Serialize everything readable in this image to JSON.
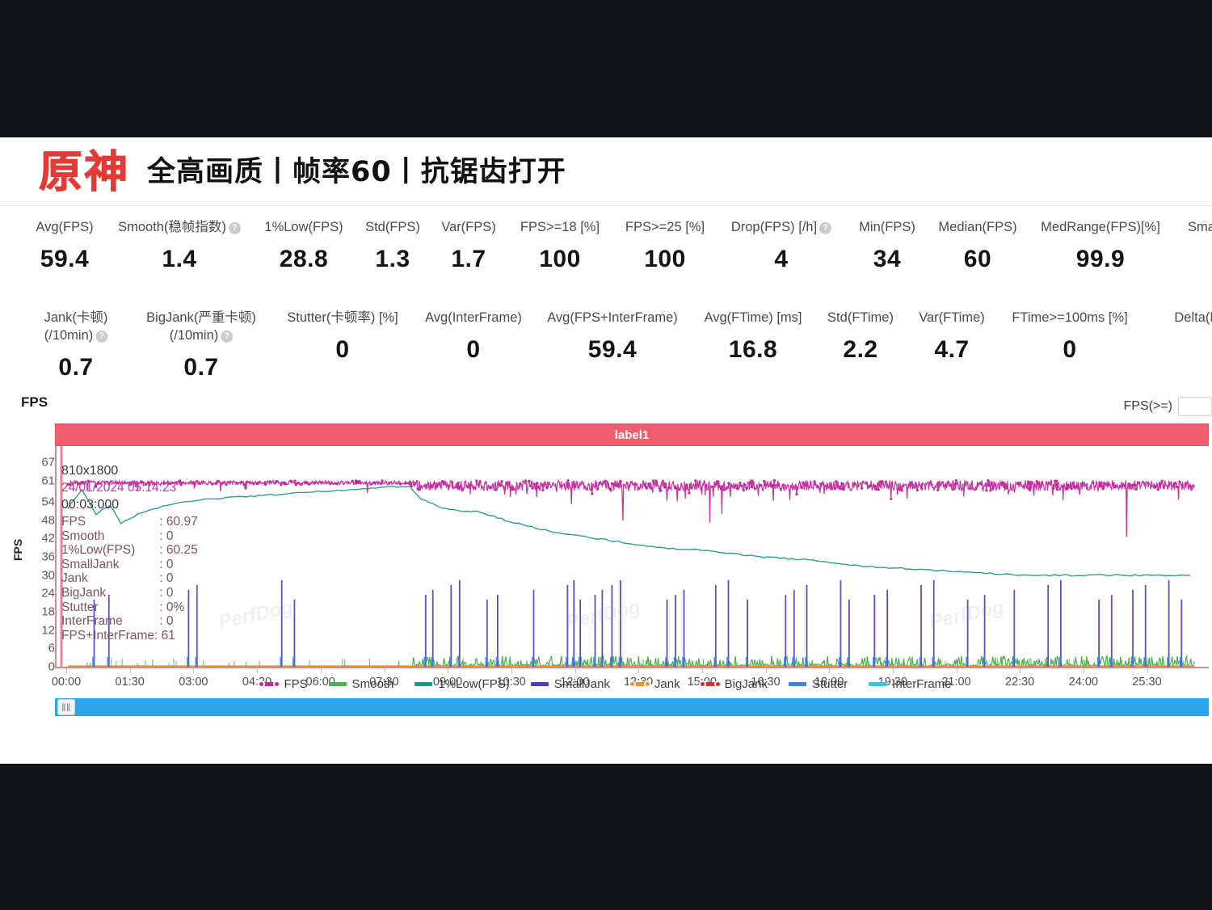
{
  "header": {
    "game_logo": "原神",
    "settings_text": "全高画质丨帧率60丨抗锯齿打开"
  },
  "stats_row1": [
    {
      "label": "Avg(FPS)",
      "value": "59.4",
      "help": false
    },
    {
      "label": "Smooth(稳帧指数)",
      "value": "1.4",
      "help": true
    },
    {
      "label": "1%Low(FPS)",
      "value": "28.8",
      "help": false
    },
    {
      "label": "Std(FPS)",
      "value": "1.3",
      "help": false
    },
    {
      "label": "Var(FPS)",
      "value": "1.7",
      "help": false
    },
    {
      "label": "FPS>=18 [%]",
      "value": "100",
      "help": false
    },
    {
      "label": "FPS>=25 [%]",
      "value": "100",
      "help": false
    },
    {
      "label": "Drop(FPS) [/h]",
      "value": "4",
      "help": true
    },
    {
      "label": "Min(FPS)",
      "value": "34",
      "help": false
    },
    {
      "label": "Median(FPS)",
      "value": "60",
      "help": false
    },
    {
      "label": "MedRange(FPS)[%]",
      "value": "99.9",
      "help": false
    },
    {
      "label": "Sma",
      "value": "",
      "help": false
    }
  ],
  "stats_row2": [
    {
      "label": "Jank(卡顿)",
      "sub": "(/10min)",
      "value": "0.7",
      "help": true
    },
    {
      "label": "BigJank(严重卡顿)",
      "sub": "(/10min)",
      "value": "0.7",
      "help": true
    },
    {
      "label": "Stutter(卡顿率) [%]",
      "sub": "",
      "value": "0",
      "help": false
    },
    {
      "label": "Avg(InterFrame)",
      "sub": "",
      "value": "0",
      "help": false
    },
    {
      "label": "Avg(FPS+InterFrame)",
      "sub": "",
      "value": "59.4",
      "help": false
    },
    {
      "label": "Avg(FTime) [ms]",
      "sub": "",
      "value": "16.8",
      "help": false
    },
    {
      "label": "Std(FTime)",
      "sub": "",
      "value": "2.2",
      "help": false
    },
    {
      "label": "Var(FTime)",
      "sub": "",
      "value": "4.7",
      "help": false
    },
    {
      "label": "FTime>=100ms [%]",
      "sub": "",
      "value": "0",
      "help": false
    },
    {
      "label": "Delta(FTi",
      "sub": "",
      "value": "",
      "help": false
    }
  ],
  "chart_panel": {
    "heading": "FPS",
    "filter_label": "FPS(>=)",
    "filter_value": "",
    "series_label_bar": "label1",
    "scroll_grip": "‖‖"
  },
  "tooltip": {
    "resolution": "810x1800",
    "datetime": "24/01/2024 05:14:23",
    "elapsed": "00:03:000",
    "rows": [
      {
        "key": "FPS",
        "value": ": 60.97"
      },
      {
        "key": "Smooth",
        "value": ": 0"
      },
      {
        "key": "1%Low(FPS)",
        "value": ": 60.25"
      },
      {
        "key": "SmallJank",
        "value": ": 0"
      },
      {
        "key": "Jank",
        "value": ": 0"
      },
      {
        "key": "BigJank",
        "value": ": 0"
      },
      {
        "key": "Stutter",
        "value": ": 0%"
      },
      {
        "key": "InterFrame",
        "value": ": 0"
      }
    ],
    "last_row": "FPS+InterFrame: 61"
  },
  "chart_data": {
    "type": "line",
    "title": "FPS",
    "xlabel": "",
    "ylabel": "FPS",
    "ylim": [
      0,
      70
    ],
    "yticks": [
      67,
      61,
      54,
      48,
      42,
      36,
      30,
      24,
      18,
      12,
      6,
      0
    ],
    "xticks": [
      "00:00",
      "01:30",
      "03:00",
      "04:30",
      "06:00",
      "07:30",
      "09:00",
      "10:30",
      "12:00",
      "13:30",
      "15:00",
      "16:30",
      "18:00",
      "19:30",
      "21:00",
      "22:30",
      "24:00",
      "25:30"
    ],
    "xlim_minutes": [
      0,
      26.5
    ],
    "grid": false,
    "legend_position": "bottom",
    "series": [
      {
        "name": "FPS",
        "color": "#c2299b",
        "type": "scatter-line",
        "description": "Dense magenta band oscillating around 59-61 across the whole run with occasional dips to 34-55.",
        "mean": 59.4,
        "min": 34,
        "max": 61
      },
      {
        "name": "Smooth",
        "color": "#4caf50",
        "type": "line",
        "description": "Green low-amplitude noise near 0-4 starting around 08:10.",
        "mean": 1.4
      },
      {
        "name": "1%Low(FPS)",
        "color": "#2e9e93",
        "type": "line",
        "description": "Teal curve: rises from ~48 at 00:00 to ~61 by 08:00, then declines steadily to ~30 by 21:00 and flattens near 30.",
        "points": [
          {
            "t": "00:00",
            "v": 52
          },
          {
            "t": "00:20",
            "v": 58
          },
          {
            "t": "00:40",
            "v": 50
          },
          {
            "t": "01:00",
            "v": 53
          },
          {
            "t": "01:15",
            "v": 47
          },
          {
            "t": "01:40",
            "v": 50
          },
          {
            "t": "02:20",
            "v": 53
          },
          {
            "t": "03:20",
            "v": 55
          },
          {
            "t": "04:30",
            "v": 56
          },
          {
            "t": "05:30",
            "v": 57
          },
          {
            "t": "06:40",
            "v": 58
          },
          {
            "t": "07:40",
            "v": 59
          },
          {
            "t": "08:05",
            "v": 59
          },
          {
            "t": "08:20",
            "v": 55
          },
          {
            "t": "08:50",
            "v": 52
          },
          {
            "t": "09:20",
            "v": 51
          },
          {
            "t": "09:40",
            "v": 51
          },
          {
            "t": "10:20",
            "v": 48
          },
          {
            "t": "11:10",
            "v": 45
          },
          {
            "t": "12:00",
            "v": 43
          },
          {
            "t": "13:00",
            "v": 41
          },
          {
            "t": "14:00",
            "v": 39
          },
          {
            "t": "15:10",
            "v": 38
          },
          {
            "t": "16:20",
            "v": 36
          },
          {
            "t": "17:30",
            "v": 35
          },
          {
            "t": "18:40",
            "v": 33
          },
          {
            "t": "20:00",
            "v": 32
          },
          {
            "t": "21:10",
            "v": 31
          },
          {
            "t": "22:30",
            "v": 30
          },
          {
            "t": "24:00",
            "v": 30
          },
          {
            "t": "25:30",
            "v": 30
          },
          {
            "t": "26:30",
            "v": 30
          }
        ],
        "final_value": 28.8
      },
      {
        "name": "SmallJank",
        "color": "#4b3fbf",
        "type": "spikes",
        "description": "Dark blue vertical spikes reaching ~24-28 scattered throughout the run."
      },
      {
        "name": "Jank",
        "color": "#f0922b",
        "type": "spikes",
        "description": "Orange baseline, essentially zero."
      },
      {
        "name": "BigJank",
        "color": "#d32f2f",
        "type": "spikes",
        "description": "Red baseline, essentially zero."
      },
      {
        "name": "Stutter",
        "color": "#2f80ed",
        "type": "spikes",
        "description": "Blue low bars near baseline co-located with SmallJank spikes."
      },
      {
        "name": "InterFrame",
        "color": "#35c6dd",
        "type": "line",
        "description": "Cyan baseline near zero."
      }
    ]
  },
  "legend": [
    {
      "label": "FPS",
      "color": "#c2299b",
      "dot": true
    },
    {
      "label": "Smooth",
      "color": "#4caf50",
      "dot": false
    },
    {
      "label": "1%Low(FPS)",
      "color": "#1e9688",
      "dot": false
    },
    {
      "label": "SmallJank",
      "color": "#4b3fbf",
      "dot": false
    },
    {
      "label": "Jank",
      "color": "#f0922b",
      "dot": true
    },
    {
      "label": "BigJank",
      "color": "#d32f2f",
      "dot": true
    },
    {
      "label": "Stutter",
      "color": "#3b82e0",
      "dot": false
    },
    {
      "label": "InterFrame",
      "color": "#35c6dd",
      "dot": false
    }
  ],
  "watermarks": [
    "PerfDog",
    "PerfDog",
    "PerfDog",
    "PerfDog",
    "PerfDog"
  ]
}
